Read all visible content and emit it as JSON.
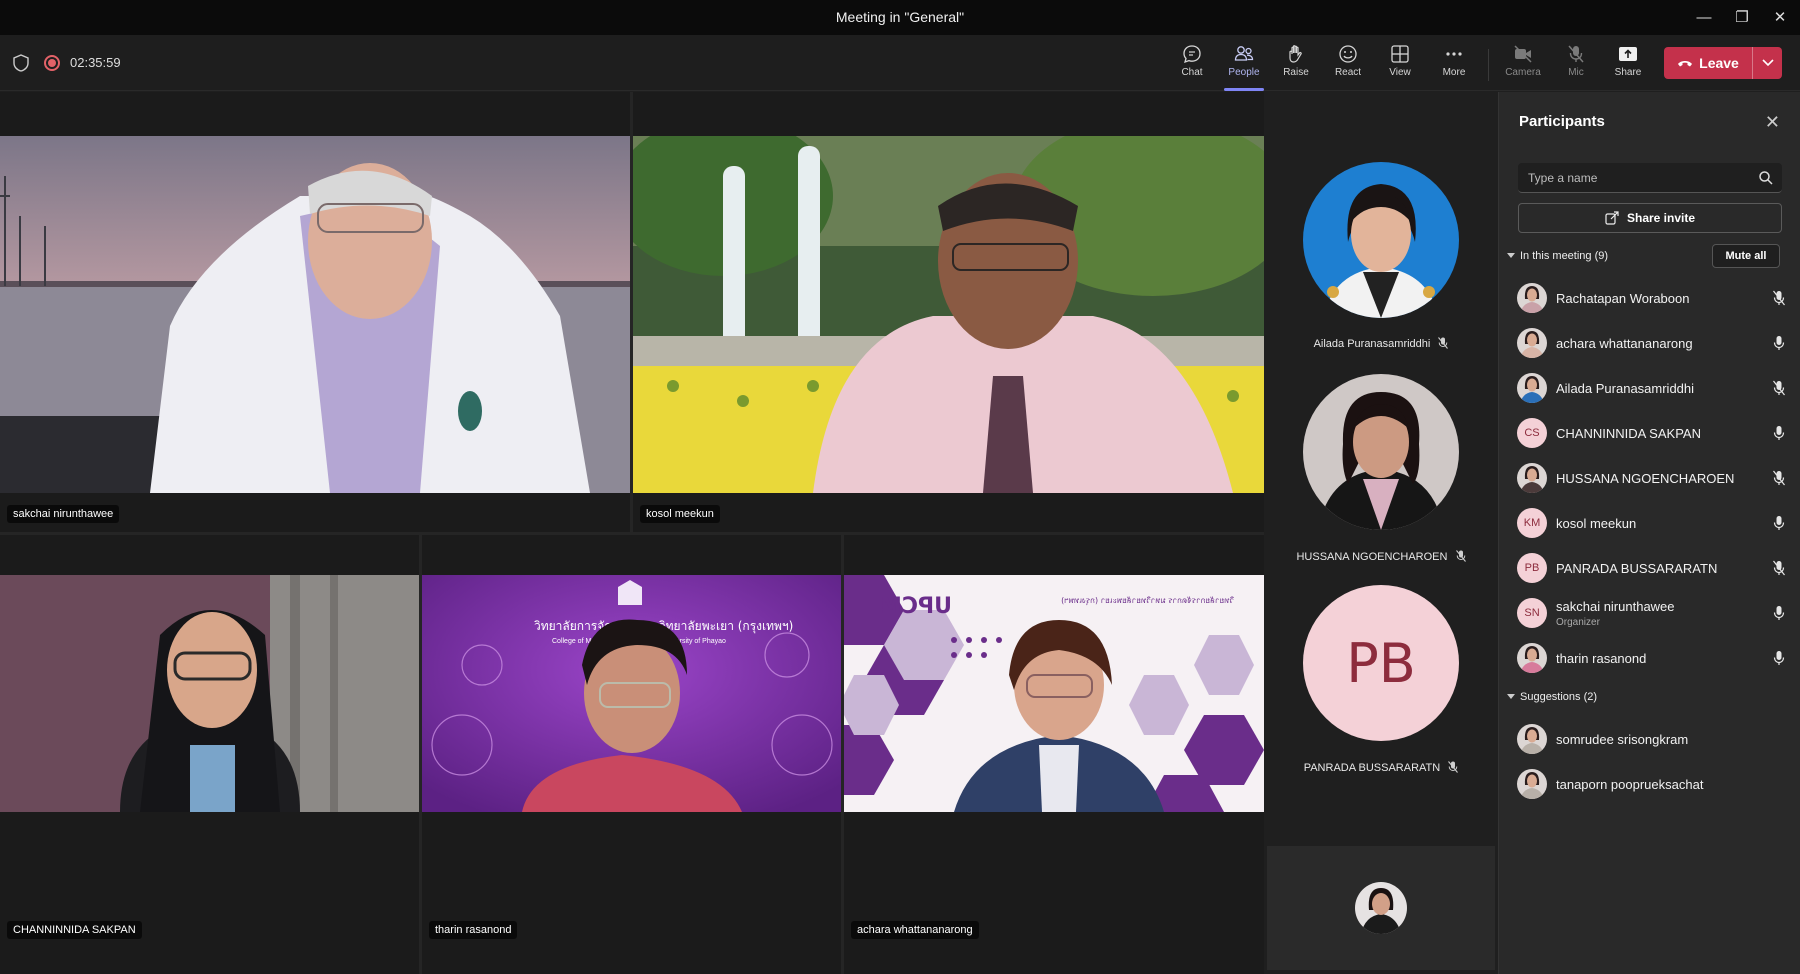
{
  "window": {
    "title": "Meeting in \"General\""
  },
  "toolbar": {
    "timer": "02:35:59",
    "buttons": [
      {
        "label": "Chat",
        "icon": "chat-icon"
      },
      {
        "label": "People",
        "icon": "people-icon",
        "active": true
      },
      {
        "label": "Raise",
        "icon": "raise-hand-icon"
      },
      {
        "label": "React",
        "icon": "react-icon"
      },
      {
        "label": "View",
        "icon": "view-icon"
      },
      {
        "label": "More",
        "icon": "more-icon"
      },
      {
        "label": "Camera",
        "icon": "camera-off-icon"
      },
      {
        "label": "Mic",
        "icon": "mic-off-icon"
      },
      {
        "label": "Share",
        "icon": "share-icon"
      }
    ],
    "leave_label": "Leave"
  },
  "stage": {
    "tiles": [
      {
        "name": "sakchai nirunthawee"
      },
      {
        "name": "kosol meekun"
      },
      {
        "name": "CHANNINNIDA SAKPAN"
      },
      {
        "name": "tharin rasanond"
      },
      {
        "name": "achara whattananarong"
      }
    ],
    "tile_logos": {
      "upcm_text": "UPCM",
      "college_thai": "วิทยาลัยการจัดการ มหาวิทยาลัยพะเยา (กรุงเทพฯ)",
      "college_english": "College of Management Bangkok - University of Phayao"
    }
  },
  "strip": {
    "people": [
      {
        "name": "Ailada Puranasamriddhi"
      },
      {
        "name": "HUSSANA NGOENCHAROEN"
      },
      {
        "name": "PANRADA BUSSARARATN",
        "initials": "PB"
      }
    ]
  },
  "panel": {
    "title": "Participants",
    "search_placeholder": "Type a name",
    "share_invite_label": "Share invite",
    "in_meeting_label": "In this meeting (9)",
    "mute_all_label": "Mute all",
    "participants": [
      {
        "name": "Rachatapan Woraboon",
        "mic": "muted"
      },
      {
        "name": "achara whattananarong",
        "mic": "on"
      },
      {
        "name": "Ailada Puranasamriddhi",
        "mic": "muted"
      },
      {
        "name": "CHANNINNIDA SAKPAN",
        "initials": "CS",
        "mic": "on"
      },
      {
        "name": "HUSSANA NGOENCHAROEN",
        "mic": "muted"
      },
      {
        "name": "kosol meekun",
        "initials": "KM",
        "mic": "on"
      },
      {
        "name": "PANRADA BUSSARARATN",
        "initials": "PB",
        "mic": "muted"
      },
      {
        "name": "sakchai nirunthawee",
        "initials": "SN",
        "subtitle": "Organizer",
        "mic": "on"
      },
      {
        "name": "tharin rasanond",
        "mic": "on"
      }
    ],
    "suggestions_label": "Suggestions (2)",
    "suggestions": [
      {
        "name": "somrudee srisongkram"
      },
      {
        "name": "tanaporn pooprueksachat"
      }
    ]
  },
  "colors": {
    "accent": "#7f85f5",
    "leave": "#c4314b",
    "avatar_bg": "#f4d1d7",
    "avatar_text": "#8d2c3d"
  }
}
